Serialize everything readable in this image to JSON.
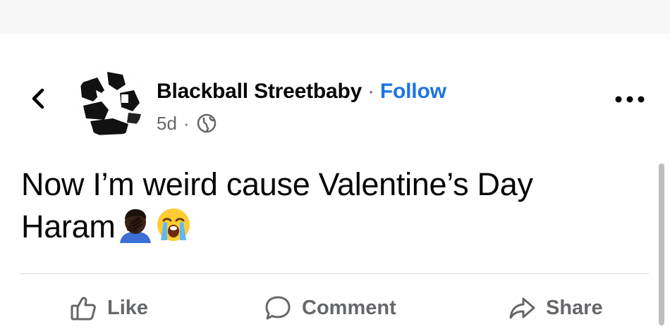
{
  "header": {
    "back_icon": "chevron-left-icon"
  },
  "post": {
    "author": {
      "name": "Blackball Streetbaby",
      "separator": "·",
      "follow_label": "Follow",
      "avatar": "profile-photo"
    },
    "meta": {
      "time": "5d",
      "separator": "·",
      "audience_icon": "globe-icon"
    },
    "more_icon": "more-horizontal-icon",
    "text_line1": "Now I’m weird cause Valentine’s Day",
    "text_line2": "Haram",
    "emojis": [
      "face-palm-emoji",
      "loudly-crying-face-emoji"
    ]
  },
  "actions": {
    "like_label": "Like",
    "comment_label": "Comment",
    "share_label": "Share"
  },
  "colors": {
    "link_blue": "#1b74e4",
    "muted_gray": "#65676b",
    "text": "#050505"
  }
}
